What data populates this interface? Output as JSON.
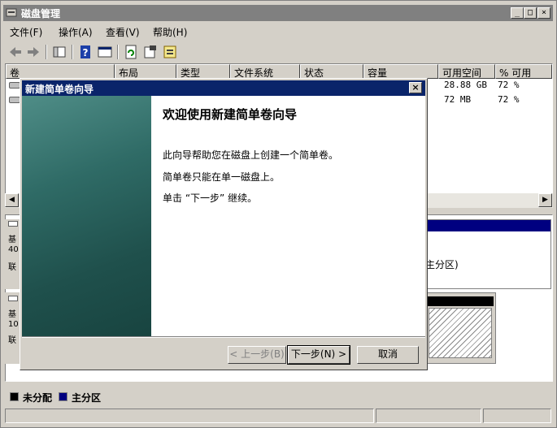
{
  "window": {
    "title": "磁盘管理",
    "minimize": "_",
    "maximize": "□",
    "close": "×"
  },
  "menu": [
    "文件(F)",
    "操作(A)",
    "查看(V)",
    "帮助(H)"
  ],
  "toolbar": [
    "back-icon",
    "forward-icon",
    "show-hide-tree-icon",
    "help-icon",
    "console-icon",
    "refresh-icon",
    "properties-icon",
    "rescan-icon"
  ],
  "volume_list": {
    "columns": [
      "卷",
      "布局",
      "类型",
      "文件系统",
      "状态",
      "容量",
      "可用空间",
      "% 可用"
    ],
    "rows": [
      {
        "free": "28.88 GB",
        "pct": "72 %"
      },
      {
        "free": "72 MB",
        "pct": "72 %"
      }
    ]
  },
  "disk_map": {
    "disks": [
      {
        "line1": "基",
        "line2": "40",
        "line3": "联"
      },
      {
        "line1": "基",
        "line2": "10",
        "line3": "联"
      }
    ],
    "partition_text": "主分区)"
  },
  "legend": [
    {
      "label": "未分配",
      "color": "#000000"
    },
    {
      "label": "主分区",
      "color": "#000080"
    }
  ],
  "wizard": {
    "title": "新建简单卷向导",
    "close": "×",
    "heading": "欢迎使用新建简单卷向导",
    "lines": [
      "此向导帮助您在磁盘上创建一个简单卷。",
      "简单卷只能在单一磁盘上。",
      "单击 “下一步” 继续。"
    ],
    "back_button": "< 上一步(B)",
    "next_button": "下一步(N) >",
    "cancel_button": "取消"
  },
  "colors": {
    "titlebar_active": "#0a246a",
    "titlebar_inactive": "#808080",
    "face": "#d4d0c8"
  }
}
